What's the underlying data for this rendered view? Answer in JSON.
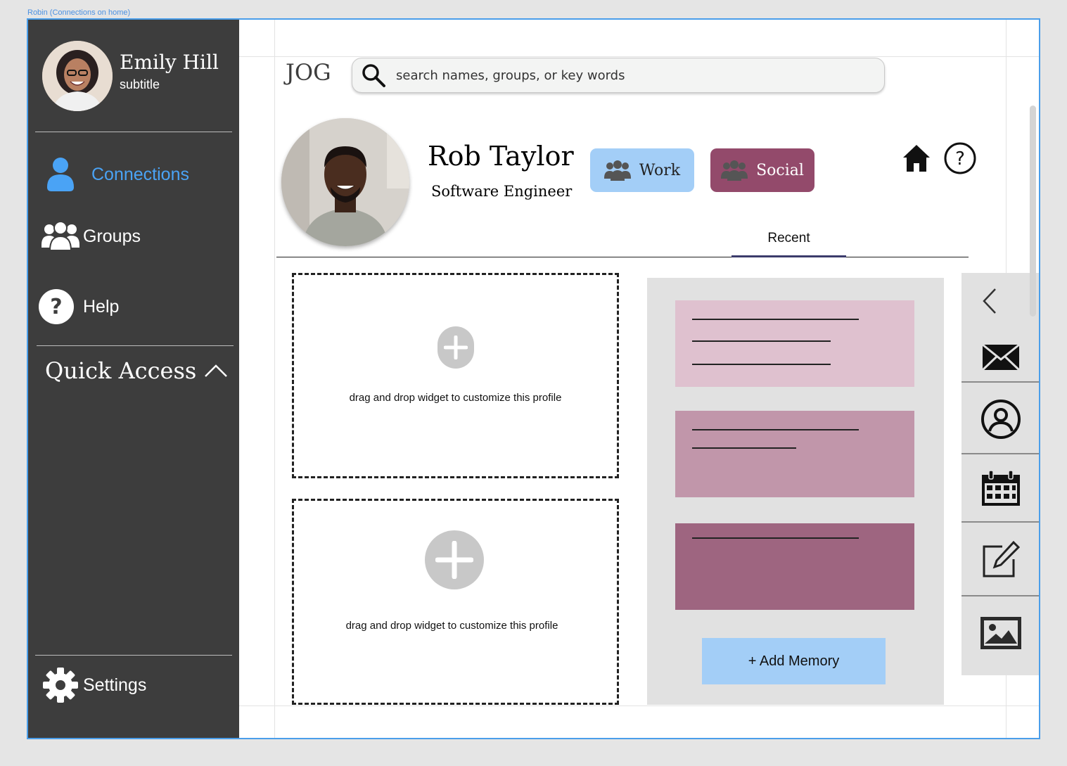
{
  "frame": {
    "label": "Robin (Connections on home)"
  },
  "user": {
    "name": "Emily Hill",
    "subtitle": "subtitle"
  },
  "sidebar": {
    "items": [
      {
        "label": "Connections",
        "icon": "person-icon",
        "active": true
      },
      {
        "label": "Groups",
        "icon": "group-icon"
      },
      {
        "label": "Help",
        "icon": "help-icon"
      }
    ],
    "quick_access": "Quick Access",
    "settings": "Settings"
  },
  "app": {
    "logo": "JOG"
  },
  "search": {
    "placeholder": "search names, groups, or key words"
  },
  "contact": {
    "name": "Rob Taylor",
    "title": "Software Engineer"
  },
  "tags": [
    {
      "label": "Work",
      "color": "#a3cef7"
    },
    {
      "label": "Social",
      "color": "#934a6b"
    }
  ],
  "tabs": [
    {
      "label": "Recent",
      "active": true
    }
  ],
  "widgets": [
    {
      "text": "drag and drop widget to customize this profile"
    },
    {
      "text": "drag and drop widget to customize this profile"
    }
  ],
  "memories": {
    "cards": [
      {
        "color": "#dfc1cf"
      },
      {
        "color": "#c196aa"
      },
      {
        "color": "#9e6580"
      }
    ],
    "add_label": "+ Add Memory"
  },
  "toolbar": {
    "icons": [
      "chevron-left-icon",
      "mail-icon",
      "profile-icon",
      "calendar-icon",
      "edit-icon",
      "image-icon"
    ]
  },
  "colors": {
    "sidebar": "#3d3d3d",
    "accent": "#4aa3f5",
    "work": "#a3cef7",
    "social": "#934a6b"
  }
}
